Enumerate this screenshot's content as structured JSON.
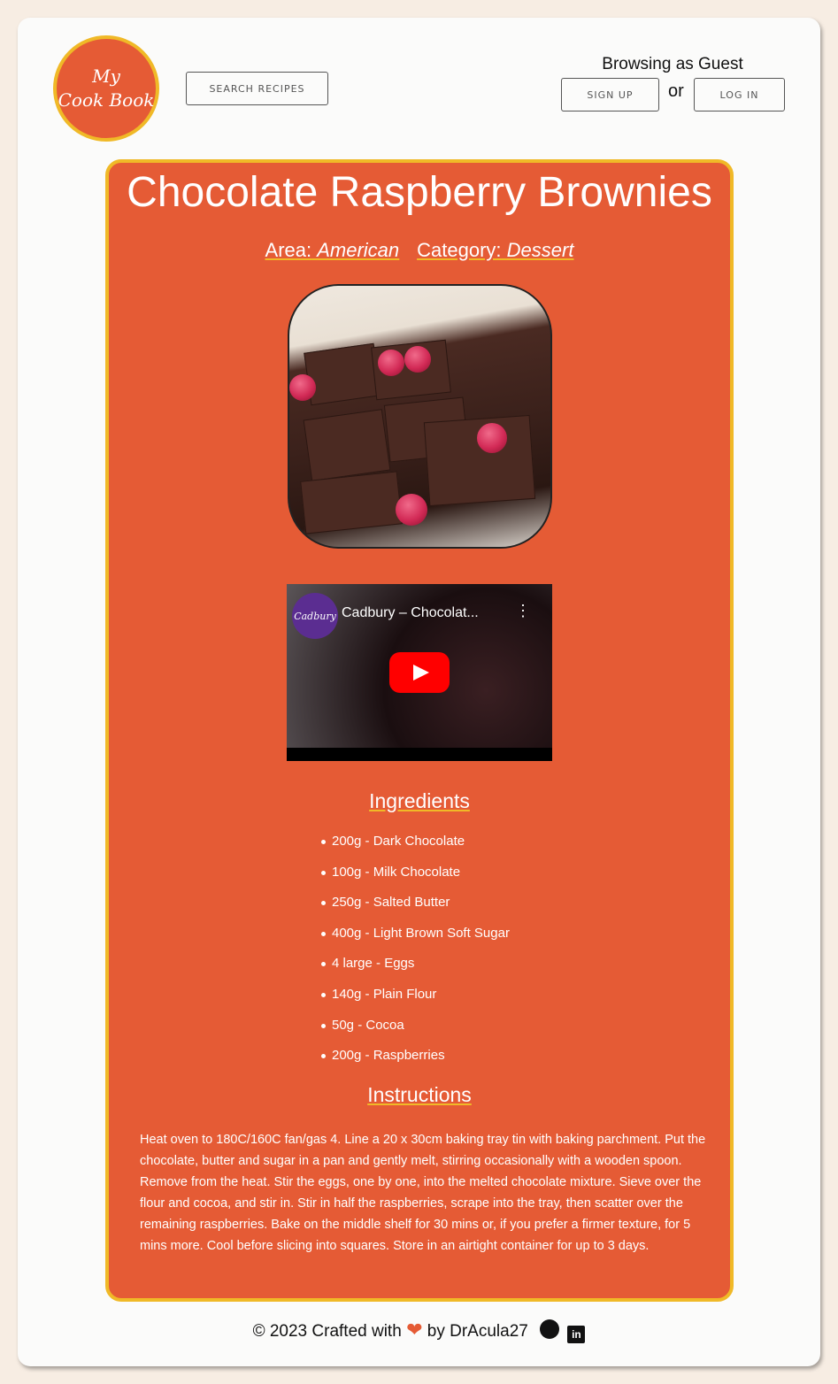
{
  "header": {
    "logo_line1": "My",
    "logo_line2": "Cook Book",
    "search_label": "SEARCH RECIPES",
    "guest_text": "Browsing as Guest",
    "or_text": "or",
    "signup_label": "SIGN UP",
    "login_label": "LOG IN"
  },
  "recipe": {
    "title": "Chocolate Raspberry Brownies",
    "area_label": "Area:",
    "area_value": "American",
    "category_label": "Category:",
    "category_value": "Dessert",
    "video": {
      "channel": "Cadbury",
      "title": "Cadbury – Chocolat..."
    },
    "ingredients_heading": "Ingredients",
    "ingredients": [
      "200g - Dark Chocolate",
      "100g - Milk Chocolate",
      "250g - Salted Butter",
      "400g - Light Brown Soft Sugar",
      "4 large - Eggs",
      "140g - Plain Flour",
      "50g - Cocoa",
      "200g - Raspberries"
    ],
    "instructions_heading": "Instructions",
    "instructions": "Heat oven to 180C/160C fan/gas 4. Line a 20 x 30cm baking tray tin with baking parchment. Put the chocolate, butter and sugar in a pan and gently melt, stirring occasionally with a wooden spoon. Remove from the heat. Stir the eggs, one by one, into the melted chocolate mixture. Sieve over the flour and cocoa, and stir in. Stir in half the raspberries, scrape into the tray, then scatter over the remaining raspberries. Bake on the middle shelf for 30 mins or, if you prefer a firmer texture, for 5 mins more. Cool before slicing into squares. Store in an airtight container for up to 3 days."
  },
  "footer": {
    "copyright": "© 2023 Crafted with",
    "by_text": "by DrAcula27",
    "linkedin_glyph": "in"
  },
  "colors": {
    "accent": "#e55b35",
    "border": "#f0b927",
    "background": "#f7ede3",
    "card": "#fbfbfa"
  }
}
